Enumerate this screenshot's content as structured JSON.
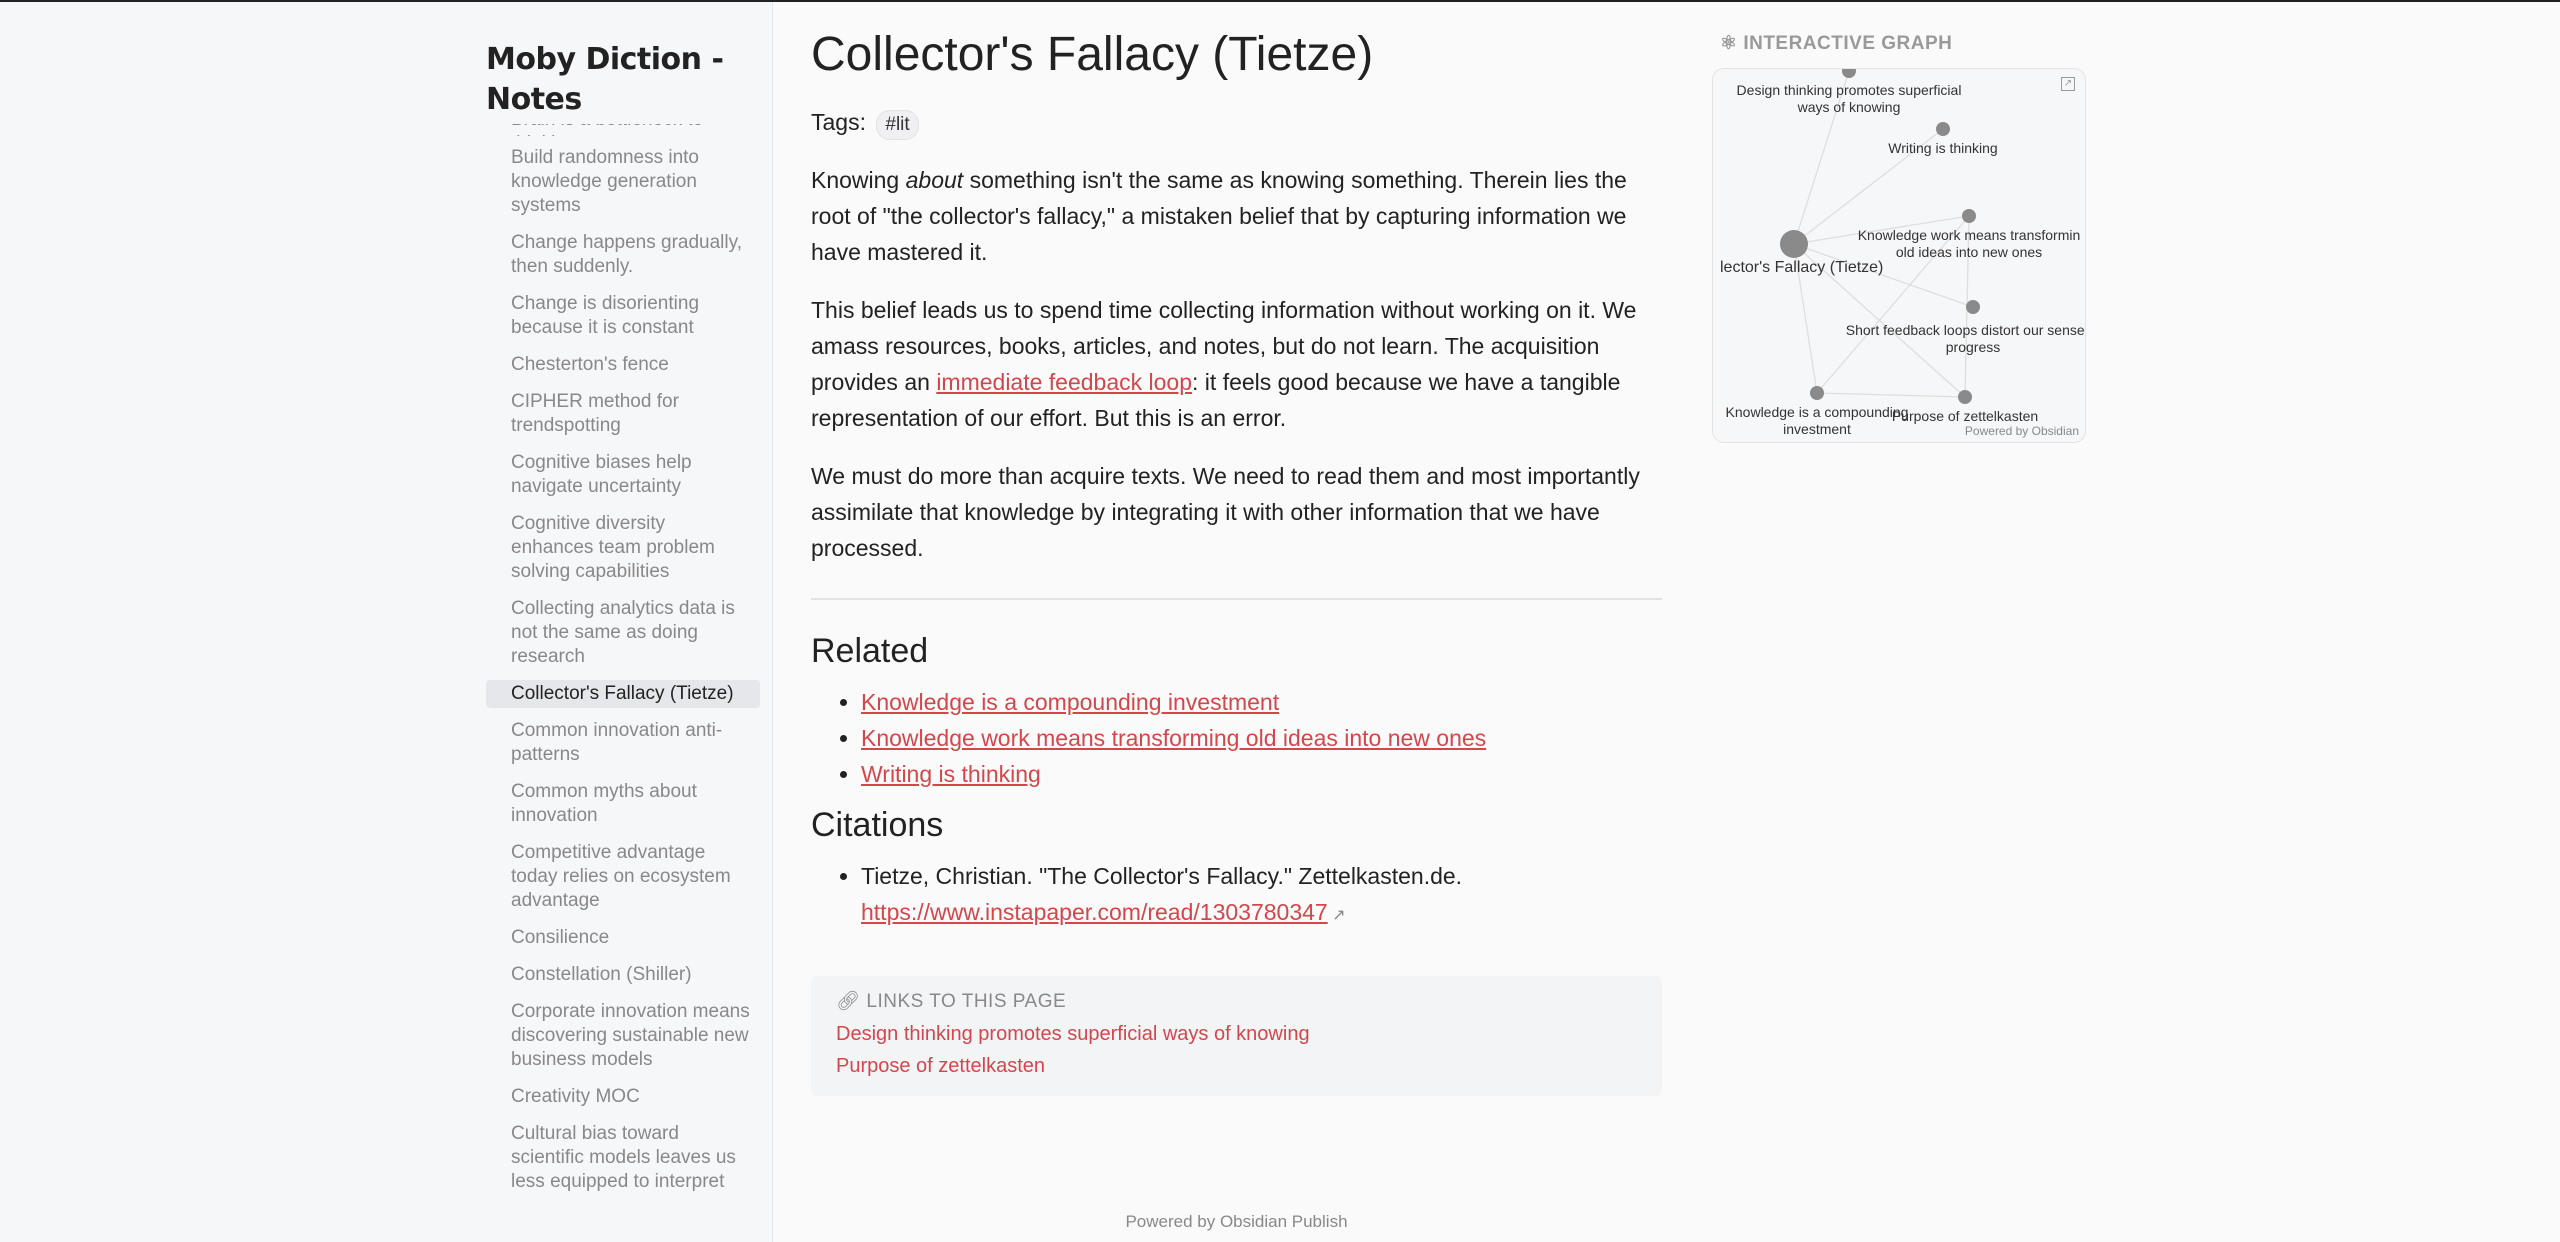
{
  "site_title": "Moby Diction - Notes",
  "nav_cut": "Brain is a bottleneck to thinking",
  "nav": [
    "Build randomness into knowledge generation systems",
    "Change happens gradually, then suddenly.",
    "Change is disorienting because it is constant",
    "Chesterton's fence",
    "CIPHER method for trendspotting",
    "Cognitive biases help navigate uncertainty",
    "Cognitive diversity enhances team problem solving capabilities",
    "Collecting analytics data is not the same as doing research",
    "Collector's Fallacy (Tietze)",
    "Common innovation anti-patterns",
    "Common myths about innovation",
    "Competitive advantage today relies on ecosystem advantage",
    "Consilience",
    "Constellation (Shiller)",
    "Corporate innovation means discovering sustainable new business models",
    "Creativity MOC",
    "Cultural bias toward scientific models leaves us less equipped to interpret"
  ],
  "active_nav": "Collector's Fallacy (Tietze)",
  "page": {
    "title": "Collector's Fallacy (Tietze)",
    "tags_label": "Tags:",
    "tag": "#lit",
    "p1a": "Knowing ",
    "p1em": "about",
    "p1b": " something isn't the same as knowing something. Therein lies the root of \"the collector's fallacy,\" a mistaken belief that by capturing information we have mastered it.",
    "p2a": "This belief leads us to spend time collecting information without working on it. We amass resources, books, articles, and notes, but do not learn. The acquisition provides an ",
    "p2link": "immediate feedback loop",
    "p2b": ": it feels good because we have a tangible representation of our effort. But this is an error.",
    "p3": "We must do more than acquire texts. We need to read them and most importantly assimilate that knowledge by integrating it with other information that we have processed.",
    "related_heading": "Related",
    "related": [
      "Knowledge is a compounding investment",
      "Knowledge work means transforming old ideas into new ones",
      "Writing is thinking"
    ],
    "citations_heading": "Citations",
    "citation_text": "Tietze, Christian. \"The Collector's Fallacy.\" Zettelkasten.de.",
    "citation_url": "https://www.instapaper.com/read/1303780347",
    "backlinks_heading": "LINKS TO THIS PAGE",
    "backlinks": [
      "Design thinking promotes superficial ways of knowing",
      "Purpose of zettelkasten"
    ]
  },
  "footer": "Powered by Obsidian Publish",
  "graph": {
    "heading": "INTERACTIVE GRAPH",
    "credit": "Powered by Obsidian",
    "nodes": [
      "Design thinking promotes superficial ways of knowing",
      "Writing is thinking",
      "Knowledge work means transforming old ideas into new ones",
      "Collector's Fallacy (Tietze)",
      "Short feedback loops distort our sense of progress",
      "Knowledge is a compounding investment",
      "Purpose of zettelkasten"
    ],
    "node_color": "#8a8a8a",
    "accent": "#d3474b"
  }
}
